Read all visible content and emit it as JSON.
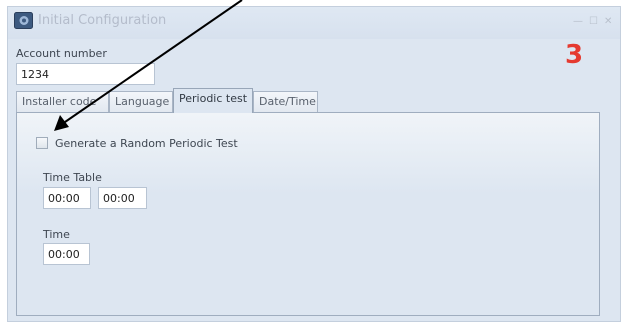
{
  "window": {
    "title": "Initial Configuration",
    "minimize_glyph": "—",
    "maximize_glyph": "☐",
    "close_glyph": "✕"
  },
  "account": {
    "label": "Account number",
    "value": "1234"
  },
  "step_number": "3",
  "tabs": [
    {
      "label": "Installer code",
      "active": false
    },
    {
      "label": "Language",
      "active": false
    },
    {
      "label": "Periodic test",
      "active": true
    },
    {
      "label": "Date/Time",
      "active": false
    }
  ],
  "periodic_test": {
    "checkbox_label": "Generate a Random Periodic Test",
    "checkbox_checked": false,
    "time_table_label": "Time Table",
    "time_table_from": "00:00",
    "time_table_to": "00:00",
    "time_label": "Time",
    "time_value": "00:00"
  },
  "colors": {
    "accent_step": "#e53a30",
    "window_bg": "#dde6f1",
    "annotation_arrow": "#000000"
  }
}
